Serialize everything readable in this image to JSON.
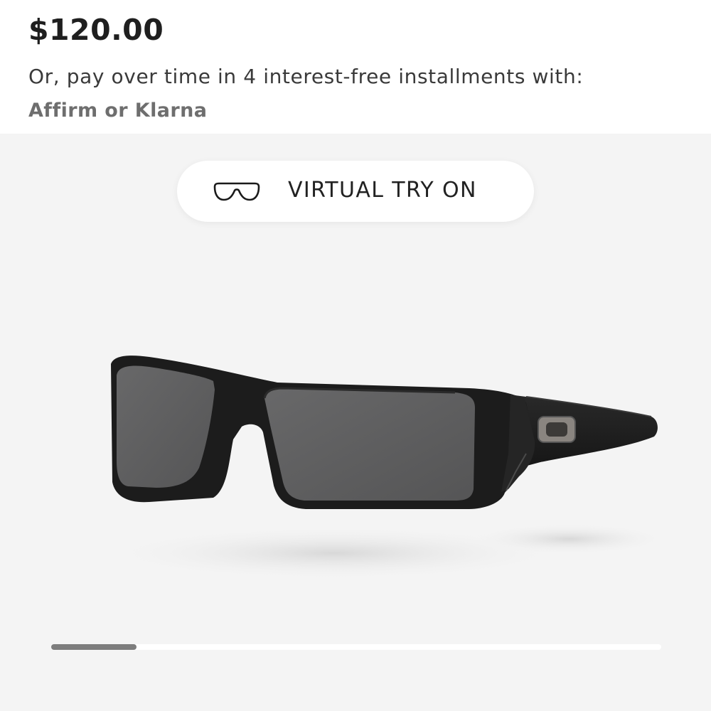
{
  "price": "$120.00",
  "installments_text": "Or, pay over time in 4 interest-free installments with:",
  "payment_providers": "Affirm or Klarna",
  "virtual_try_on": {
    "label": "VIRTUAL TRY ON",
    "icon": "glasses-outline-icon"
  },
  "product_image": {
    "icon": "sunglasses-product-image",
    "frame_color": "#1c1c1c",
    "lens_color": "#5f5f60"
  },
  "gallery": {
    "background_color": "#f4f4f4",
    "scroll_progress": 0.14
  }
}
